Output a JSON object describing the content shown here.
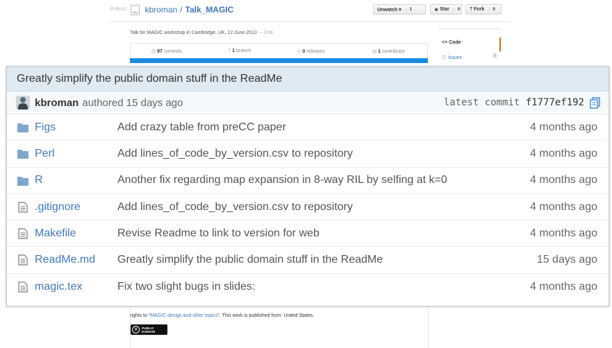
{
  "repo": {
    "visibility": "PUBLIC",
    "owner": "kbroman",
    "separator": "/",
    "name": "Talk_MAGIC",
    "description": "Talk for MAGIC workshop in Cambridge, UK, 12 June 2013",
    "edit_label": "— Edit"
  },
  "actions": {
    "unwatch": {
      "label": "Unwatch ▾",
      "count": "1"
    },
    "star": {
      "label": "Star",
      "count": "0"
    },
    "fork": {
      "label": "Fork",
      "count": "0"
    }
  },
  "stats": {
    "commits": {
      "num": "97",
      "label": "commits"
    },
    "branches": {
      "num": "1",
      "label": "branch"
    },
    "releases": {
      "num": "0",
      "label": "releases"
    },
    "contributors": {
      "num": "1",
      "label": "contributor"
    }
  },
  "sidebar": {
    "code_label": "<> Code",
    "issues_label": "Issues",
    "issues_count": "0"
  },
  "latest_commit": {
    "message": "Greatly simplify the public domain stuff in the ReadMe",
    "author": "kbroman",
    "authored_text": "authored 15 days ago",
    "latest_label": "latest commit",
    "sha": "f1777ef192"
  },
  "files": [
    {
      "type": "dir",
      "icon": "folder-icon",
      "name": "Figs",
      "message": "Add crazy table from preCC paper",
      "age": "4 months ago"
    },
    {
      "type": "dir",
      "icon": "folder-icon",
      "name": "Perl",
      "message": "Add lines_of_code_by_version.csv to repository",
      "age": "4 months ago"
    },
    {
      "type": "dir",
      "icon": "folder-icon",
      "name": "R",
      "message": "Another fix regarding map expansion in 8-way RIL by selfing at k=0",
      "age": "4 months ago"
    },
    {
      "type": "file",
      "icon": "file-icon",
      "name": ".gitignore",
      "message": "Add lines_of_code_by_version.csv to repository",
      "age": "4 months ago"
    },
    {
      "type": "file",
      "icon": "file-icon",
      "name": "Makefile",
      "message": "Revise Readme to link to version for web",
      "age": "4 months ago"
    },
    {
      "type": "file",
      "icon": "file-icon",
      "name": "ReadMe.md",
      "message": "Greatly simplify the public domain stuff in the ReadMe",
      "age": "15 days ago"
    },
    {
      "type": "file",
      "icon": "file-icon",
      "name": "magic.tex",
      "message": "Fix two slight bugs in slides:",
      "age": "4 months ago"
    }
  ],
  "footer": {
    "prefix": "rights to “",
    "link": "MAGIC design and other topics",
    "suffix": "”. This work is published from: United States.",
    "badge_symbol": "0",
    "badge_line1": "PUBLIC",
    "badge_line2": "DOMAIN"
  },
  "colors": {
    "link": "#4078c0",
    "folder": "#80a6cd",
    "commit_bar": "#dfeaf2",
    "language_bar": "#1a8be0"
  }
}
